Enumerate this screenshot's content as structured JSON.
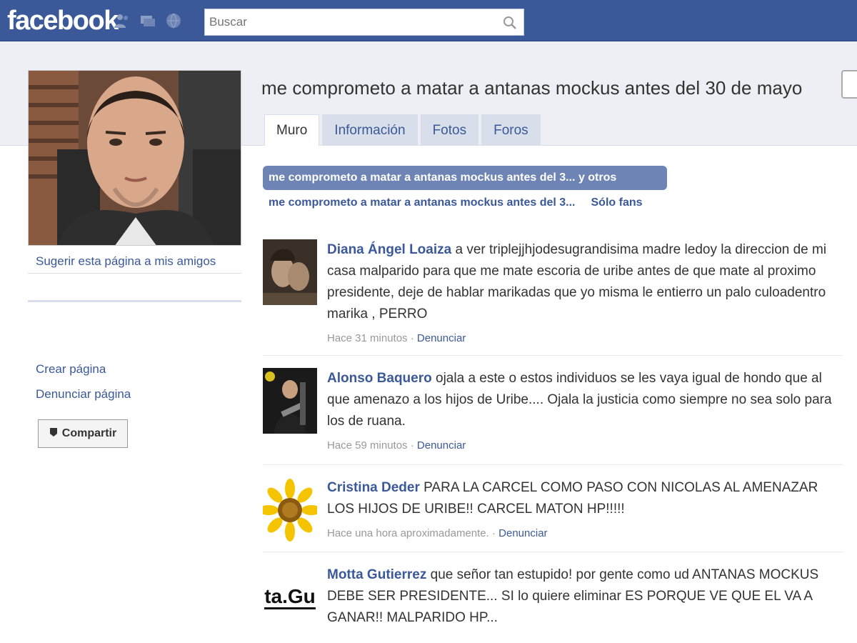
{
  "colors": {
    "brand": "#3b5998",
    "band": "#edeff4",
    "pill": "#6d84b4"
  },
  "header": {
    "logo": "facebook",
    "search": {
      "placeholder": "Buscar",
      "value": ""
    },
    "icons": [
      "friends-icon",
      "messages-icon",
      "notifications-icon",
      "search-icon"
    ]
  },
  "left": {
    "suggest_link": "Sugerir esta página a mis amigos",
    "create_page": "Crear página",
    "report_page": "Denunciar página",
    "share_button": "Compartir"
  },
  "page": {
    "title": "me comprometo a matar a antanas mockus antes del 30 de mayo",
    "tabs": [
      {
        "label": "Muro",
        "active": true
      },
      {
        "label": "Información",
        "active": false
      },
      {
        "label": "Fotos",
        "active": false
      },
      {
        "label": "Foros",
        "active": false
      }
    ],
    "filters": {
      "selected": "me comprometo a matar a antanas mockus antes del 3... y otros",
      "option_page": "me comprometo a matar a antanas mockus antes del 3...",
      "option_fans": "Sólo fans"
    }
  },
  "posts": [
    {
      "author": "Diana Ángel Loaiza",
      "text": "a ver triplejjhjodesugrandisima madre ledoy la direccion de mi casa malparido para que me mate escoria de uribe antes de que mate al proximo presidente, deje de hablar marikadas que yo misma le entierro un palo culoadentro marika , PERRO",
      "time": "Hace 31 minutos",
      "report": "Denunciar"
    },
    {
      "author": "Alonso Baquero",
      "text": "ojala a este o estos individuos se les vaya igual de hondo que al que amenazo a los hijos de Uribe.... Ojala la justicia como siempre no sea solo para los de ruana.",
      "time": "Hace 59 minutos",
      "report": "Denunciar"
    },
    {
      "author": "Cristina Deder",
      "text": "PARA LA CARCEL COMO PASO CON NICOLAS AL AMENAZAR LOS HIJOS DE URIBE!! CARCEL MATON HP!!!!!",
      "time": "Hace una hora aproximadamente.",
      "report": "Denunciar"
    },
    {
      "author": "Motta Gutierrez",
      "avatar_text": "ta.Gu",
      "text": "que señor tan estupido! por gente como ud ANTANAS MOCKUS DEBE SER PRESIDENTE... SI lo quiere eliminar ES PORQUE VE QUE EL VA A GANAR!! MALPARIDO HP...",
      "time": "",
      "report": ""
    }
  ]
}
